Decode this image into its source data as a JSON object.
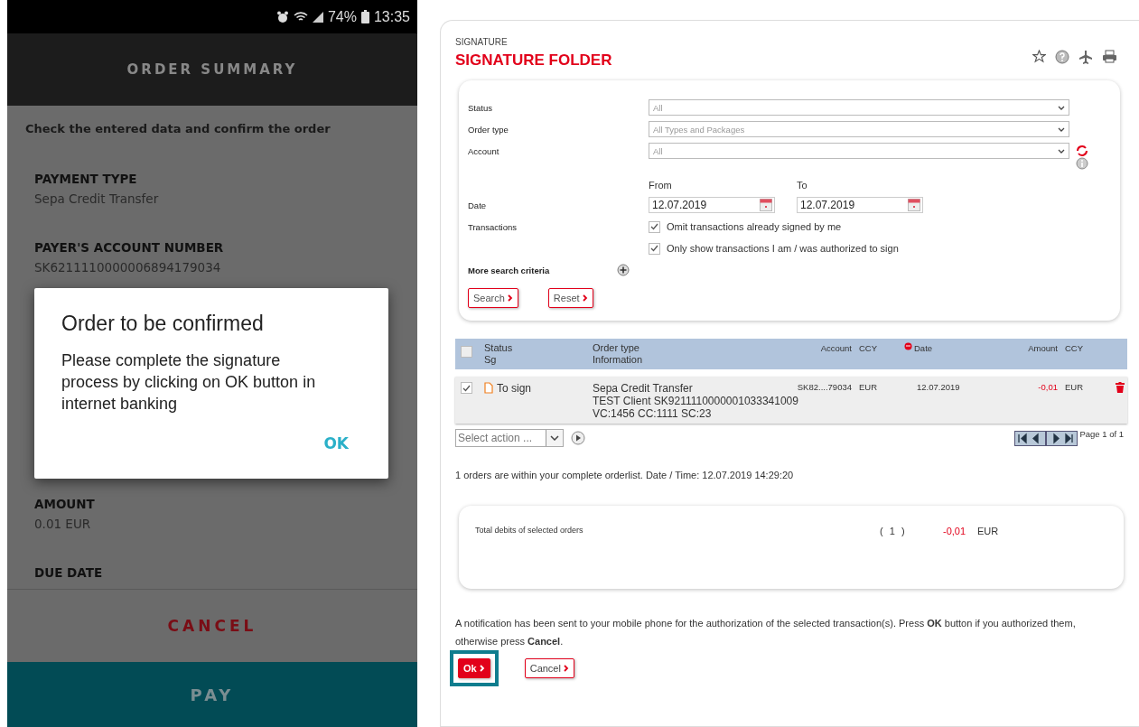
{
  "phone": {
    "status_bar": {
      "battery": "74%",
      "time": "13:35"
    },
    "header_title": "ORDER SUMMARY",
    "instruction": "Check the entered data and confirm the order",
    "fields": [
      {
        "label": "PAYMENT TYPE",
        "value": "Sepa Credit Transfer"
      },
      {
        "label": "PAYER'S ACCOUNT NUMBER",
        "value": "SK6211110000006894179034"
      },
      {
        "label": "AMOUNT",
        "value": "0.01 EUR"
      },
      {
        "label": "DUE DATE"
      }
    ],
    "dialog": {
      "title": "Order to be confirmed",
      "message": "Please complete the signature process by clicking on OK button in internet banking",
      "button": "OK"
    },
    "cancel_button": "CANCEL",
    "pay_button": "PAY"
  },
  "web": {
    "breadcrumb": "SIGNATURE",
    "title": "SIGNATURE FOLDER",
    "filters": {
      "selects": [
        {
          "label": "Status",
          "value": "All"
        },
        {
          "label": "Order type",
          "value": "All Types and Packages"
        },
        {
          "label": "Account",
          "value": "All"
        }
      ],
      "date": {
        "label": "Date",
        "from_label": "From",
        "to_label": "To",
        "from": "12.07.2019",
        "to": "12.07.2019"
      },
      "transactions_label": "Transactions",
      "checkboxes": [
        {
          "label": "Omit transactions already signed by me",
          "checked": true
        },
        {
          "label": "Only show transactions I am / was authorized to sign",
          "checked": true
        }
      ],
      "more_criteria": "More search criteria",
      "buttons": [
        "Search",
        "Reset"
      ]
    },
    "table": {
      "columns": [
        {
          "lines": [
            "Status",
            "Sg"
          ]
        },
        {
          "lines": [
            "Order type",
            "Information"
          ]
        },
        {
          "lines": [
            "Account"
          ]
        },
        {
          "lines": [
            "CCY"
          ]
        },
        {
          "lines": [
            "Date"
          ]
        },
        {
          "lines": [
            "Amount"
          ]
        },
        {
          "lines": [
            "CCY"
          ]
        }
      ],
      "all_checked": false,
      "rows": [
        {
          "checked": true,
          "status": "To sign",
          "info": [
            "Sepa Credit Transfer",
            "TEST Client SK9211110000001033341009",
            "VC:1456 CC:1111 SC:23"
          ],
          "account": "SK82....79034",
          "ccy": "EUR",
          "date": "12.07.2019",
          "amount": "-0,01",
          "amount_ccy": "EUR"
        }
      ]
    },
    "select_action": "Select action ...",
    "pagination": "Page 1 of 1",
    "summary": "1 orders are within your complete orderlist. Date / Time: 12.07.2019 14:29:20",
    "totals": {
      "label": "Total debits of selected orders",
      "count": "( 1 )",
      "amount": "-0,01",
      "ccy": "EUR"
    },
    "notice": "A notification has been sent to your mobile phone for the authorization of the selected transaction(s). Press **OK** button if you authorized them, otherwise press **Cancel**.",
    "actions": [
      {
        "label": "Ok",
        "kind": "primary",
        "highlighted": true
      },
      {
        "label": "Cancel",
        "kind": "secondary",
        "highlighted": false
      }
    ]
  }
}
